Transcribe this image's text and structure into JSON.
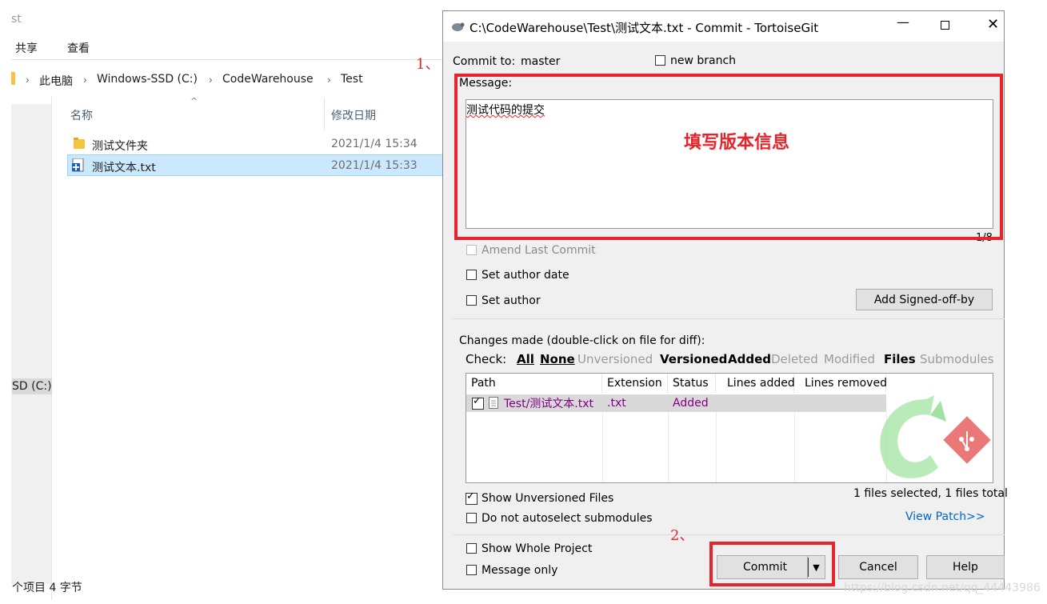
{
  "explorer": {
    "title_fragment": "st",
    "ribbon": [
      "共享",
      "查看"
    ],
    "breadcrumb": [
      "此电脑",
      "Windows-SSD (C:)",
      "CodeWarehouse",
      "Test"
    ],
    "columns": {
      "name": "名称",
      "date": "修改日期"
    },
    "files": [
      {
        "name": "测试文件夹",
        "date": "2021/1/4 15:34",
        "icon": "folder-icon"
      },
      {
        "name": "测试文本.txt",
        "date": "2021/1/4 15:33",
        "icon": "text-file-icon"
      }
    ],
    "side_drive": "SD (C:)",
    "status": "个项目  4 字节"
  },
  "dialog": {
    "title": "C:\\CodeWarehouse\\Test\\测试文本.txt - Commit - TortoiseGit",
    "commit_to_label": "Commit to:",
    "branch": "master",
    "new_branch_label": "new branch",
    "message_label": "Message:",
    "message_value": "测试代码的提交",
    "message_counter": "1/8",
    "amend_label": "Amend Last Commit",
    "set_author_date_label": "Set author date",
    "set_author_label": "Set author",
    "add_signed_off_label": "Add Signed-off-by",
    "changes_label": "Changes made (double-click on file for diff):",
    "check_label": "Check:",
    "check_filters": [
      {
        "label": "All",
        "bold": true,
        "underline": true,
        "enabled": true
      },
      {
        "label": "None",
        "bold": true,
        "underline": true,
        "enabled": true
      },
      {
        "label": "Unversioned",
        "bold": false,
        "underline": false,
        "enabled": false
      },
      {
        "label": "Versioned",
        "bold": true,
        "underline": false,
        "enabled": true
      },
      {
        "label": "Added",
        "bold": true,
        "underline": false,
        "enabled": true
      },
      {
        "label": "Deleted",
        "bold": false,
        "underline": false,
        "enabled": false
      },
      {
        "label": "Modified",
        "bold": false,
        "underline": false,
        "enabled": false
      },
      {
        "label": "Files",
        "bold": true,
        "underline": false,
        "enabled": true
      },
      {
        "label": "Submodules",
        "bold": false,
        "underline": false,
        "enabled": false
      }
    ],
    "list_headers": [
      "Path",
      "Extension",
      "Status",
      "Lines added",
      "Lines removed"
    ],
    "list_rows": [
      {
        "path": "Test/测试文本.txt",
        "extension": ".txt",
        "status": "Added",
        "lines_added": "",
        "lines_removed": "",
        "checked": true
      }
    ],
    "show_unversioned_label": "Show Unversioned Files",
    "no_autoselect_label": "Do not autoselect submodules",
    "files_summary": "1 files selected, 1 files total",
    "view_patch_label": "View Patch>>",
    "show_whole_project_label": "Show Whole Project",
    "message_only_label": "Message only",
    "commit_label": "Commit",
    "cancel_label": "Cancel",
    "help_label": "Help",
    "accent_color": "#0066cc",
    "added_color": "#800080"
  },
  "annotations": {
    "step1": "1、",
    "step2": "2、",
    "fill_info": "填写版本信息",
    "color": "#e8242b"
  },
  "watermark": "https://blog.csdn.net/qq_44443986"
}
